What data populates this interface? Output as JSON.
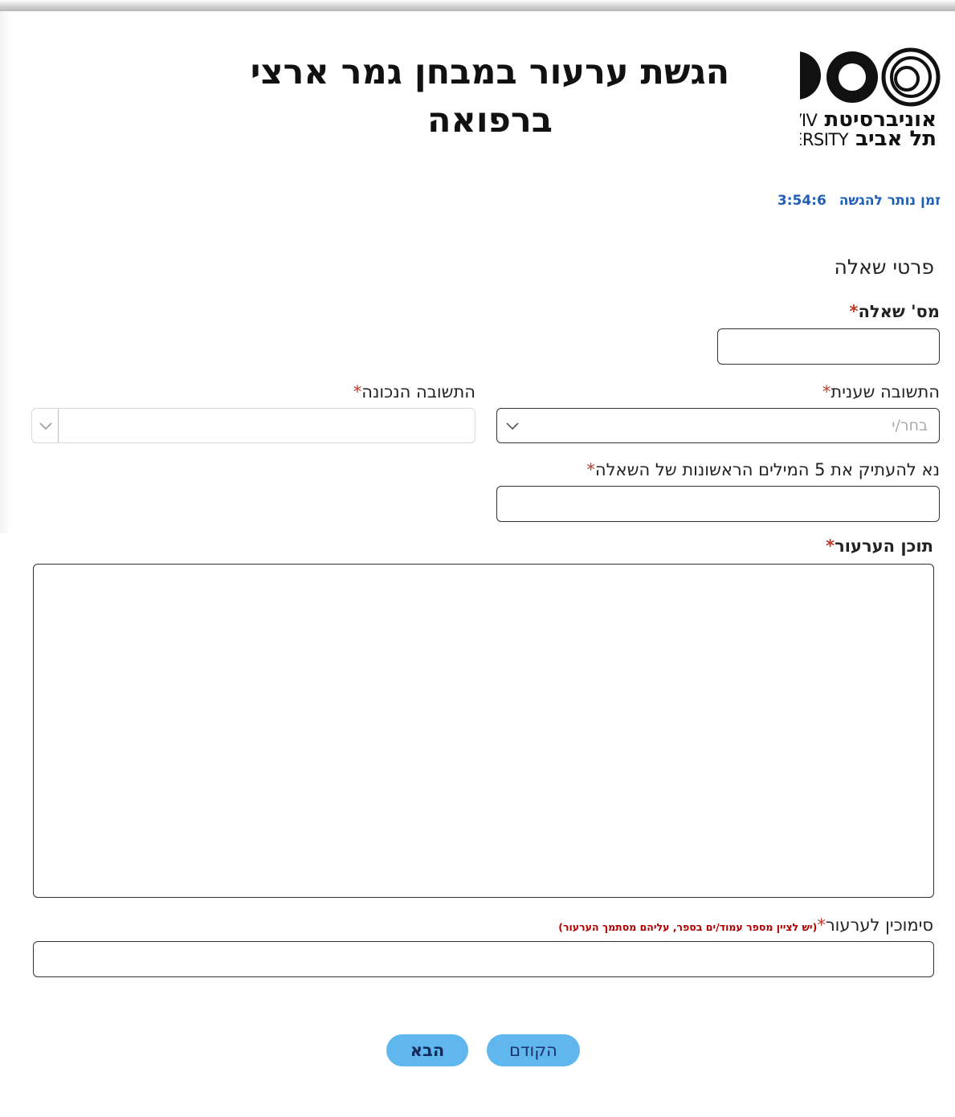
{
  "header": {
    "title_line1": "הגשת ערעור במבחן גמר ארצי",
    "title_line2": "ברפואה",
    "logo": {
      "he_line1": "אוניברסיטת",
      "en_line1": "AVIV",
      "he_line2": "תל אביב",
      "en_line2": "ERSITY"
    }
  },
  "timer": {
    "label": "זמן נותר להגשה",
    "value": "3:54:6"
  },
  "section": {
    "title": "פרטי שאלה"
  },
  "fields": {
    "question_number": {
      "label": "מס' שאלה",
      "required_mark": "*",
      "value": ""
    },
    "my_answer": {
      "label": "התשובה שענית",
      "required_mark": "*",
      "placeholder": "בחר/י"
    },
    "correct_answer": {
      "label": "התשובה הנכונה",
      "required_mark": "*",
      "placeholder": ""
    },
    "first_words": {
      "label": "נא להעתיק את 5 המילים הראשונות של השאלה",
      "required_mark": "*",
      "value": ""
    },
    "appeal_content": {
      "label": "תוכן הערעור",
      "required_mark": "*",
      "value": ""
    },
    "references": {
      "label": "סימוכין לערעור",
      "required_mark": "*",
      "hint": "(יש לציין מספר עמוד/ים בספר, עליהם מסתמך הערעור)",
      "value": ""
    }
  },
  "buttons": {
    "previous": "הקודם",
    "next": "הבא"
  },
  "colors": {
    "button_bg": "#5fb7ee",
    "timer": "#1f5fb5",
    "required": "#c0392b"
  }
}
